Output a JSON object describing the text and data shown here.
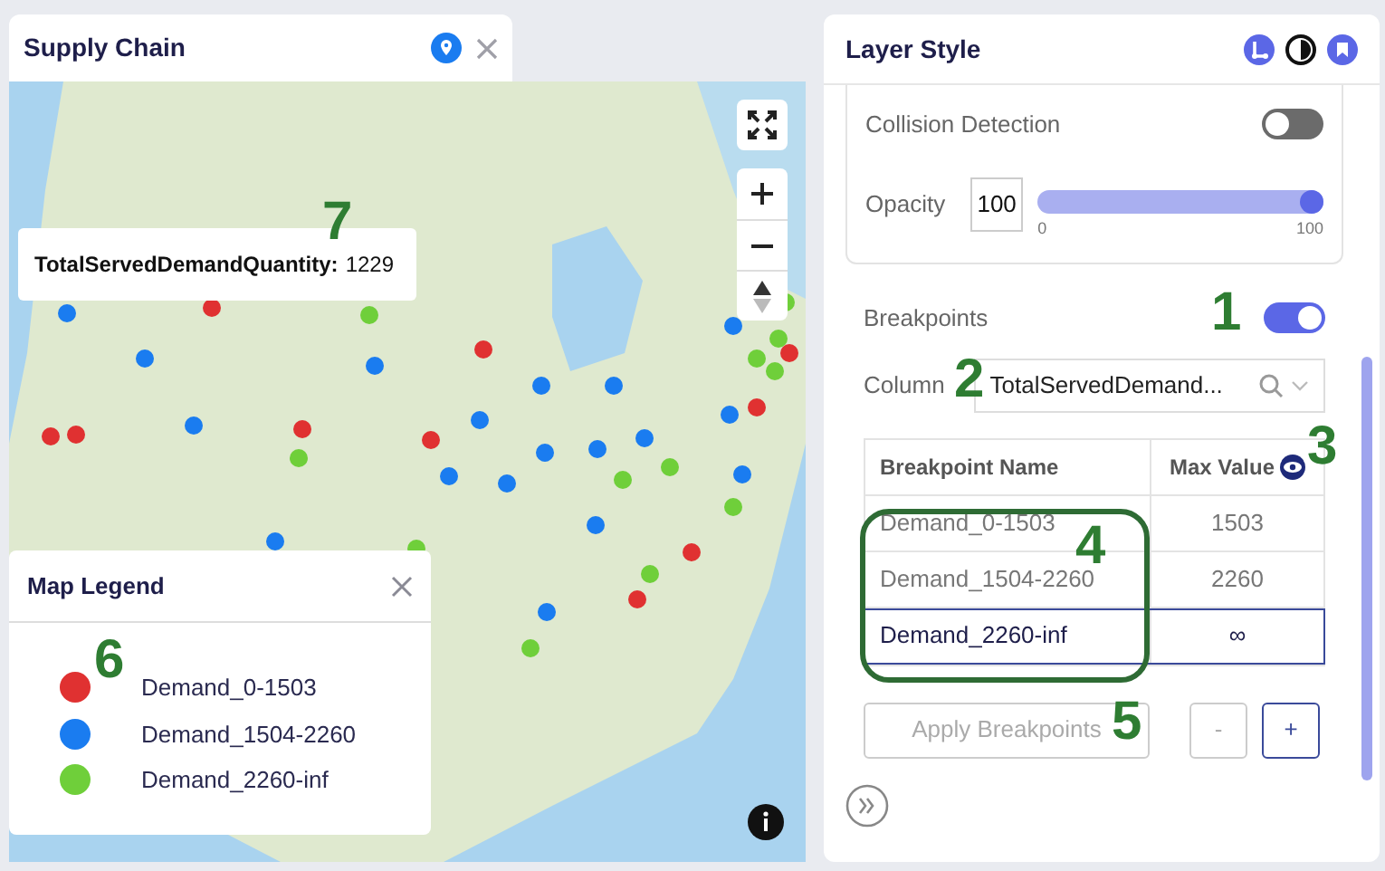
{
  "map_panel": {
    "title": "Supply Chain",
    "tooltip": {
      "label": "TotalServedDemandQuantity:",
      "value": "1229"
    },
    "legend": {
      "title": "Map Legend",
      "items": [
        {
          "label": "Demand_0-1503",
          "color": "#e03131"
        },
        {
          "label": "Demand_1504-2260",
          "color": "#1a7cf0"
        },
        {
          "label": "Demand_2260-inf",
          "color": "#6fcf3a"
        }
      ]
    }
  },
  "layer_style": {
    "title": "Layer Style",
    "collision_detection": {
      "label": "Collision Detection",
      "on": false
    },
    "opacity": {
      "label": "Opacity",
      "value": "100",
      "level": 1,
      "min": "0",
      "max": "100"
    },
    "breakpoints": {
      "label": "Breakpoints",
      "on": true
    },
    "column": {
      "label": "Column",
      "value": "TotalServedDemand..."
    },
    "table": {
      "columns": [
        "Breakpoint Name",
        "Max Value"
      ],
      "rows": [
        {
          "name": "Demand_0-1503",
          "max": "1503",
          "selected": false
        },
        {
          "name": "Demand_1504-2260",
          "max": "2260",
          "selected": false
        },
        {
          "name": "Demand_2260-inf",
          "max": "∞",
          "selected": true
        }
      ]
    },
    "buttons": [
      {
        "label": "Apply Breakpoints",
        "disabled": true
      },
      {
        "label": "-",
        "disabled": true
      },
      {
        "label": "+",
        "disabled": false
      }
    ]
  },
  "annotations": [
    "1",
    "2",
    "3",
    "4",
    "5",
    "6",
    "7"
  ]
}
